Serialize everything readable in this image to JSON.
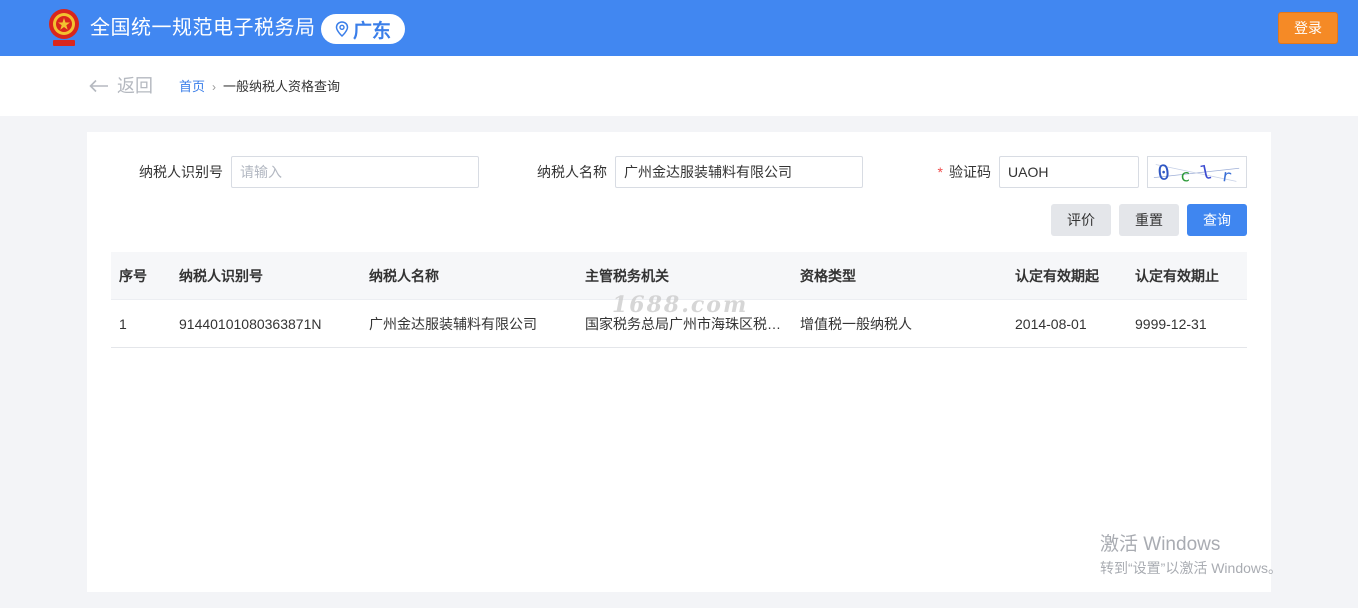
{
  "header": {
    "site_title": "全国统一规范电子税务局",
    "region": "广东",
    "login_label": "登录"
  },
  "subbar": {
    "back_label": "返回",
    "breadcrumb": [
      "首页",
      "一般纳税人资格查询"
    ]
  },
  "form": {
    "taxpayer_id_label": "纳税人识别号",
    "taxpayer_id_placeholder": "请输入",
    "taxpayer_id_value": "",
    "taxpayer_name_label": "纳税人名称",
    "taxpayer_name_value": "广州金达服装辅料有限公司",
    "captcha_required_mark": "*",
    "captcha_label": "验证码",
    "captcha_value": "UAOH",
    "captcha_image_chars": "0clr"
  },
  "actions": {
    "evaluate_label": "评价",
    "reset_label": "重置",
    "query_label": "查询"
  },
  "table": {
    "columns": [
      "序号",
      "纳税人识别号",
      "纳税人名称",
      "主管税务机关",
      "资格类型",
      "认定有效期起",
      "认定有效期止"
    ],
    "rows": [
      [
        "1",
        "91440101080363871N",
        "广州金达服装辅料有限公司",
        "国家税务总局广州市海珠区税务局",
        "增值税一般纳税人",
        "2014-08-01",
        "9999-12-31"
      ]
    ]
  },
  "overlay": {
    "watermark": "1688.com",
    "activate_title": "激活 Windows",
    "activate_subtitle": "转到“设置”以激活 Windows。"
  },
  "colors": {
    "header_bg": "#4187f1",
    "login_bg": "#f58a26",
    "primary": "#3f86f0",
    "required": "#f04b4b"
  }
}
